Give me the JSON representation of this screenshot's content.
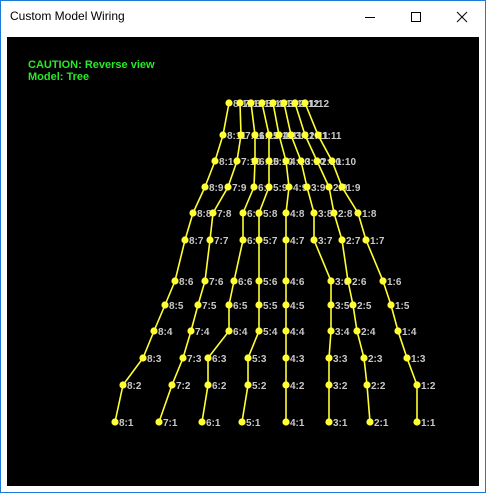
{
  "window": {
    "title": "Custom Model Wiring"
  },
  "overlay": {
    "caution": "CAUTION: Reverse view",
    "model": "Model: Tree"
  },
  "colors": {
    "background": "#000000",
    "wire": "#ffff33",
    "node": "#ffff33",
    "label": "#c8c8c8",
    "overlay_text": "#28e828"
  },
  "strings": [
    {
      "string": 8,
      "nodes": [
        "8:1",
        "8:2",
        "8:3",
        "8:4",
        "8:5",
        "8:6",
        "8:7",
        "8:8",
        "8:9",
        "8:10",
        "8:11",
        "8:12"
      ]
    },
    {
      "string": 7,
      "nodes": [
        "7:1",
        "7:2",
        "7:3",
        "7:4",
        "7:5",
        "7:6",
        "7:7",
        "7:8",
        "7:9",
        "7:10",
        "7:11",
        "7:12"
      ]
    },
    {
      "string": 6,
      "nodes": [
        "6:1",
        "6:2",
        "6:3",
        "6:4",
        "6:5",
        "6:6",
        "6:7",
        "6:8",
        "6:9",
        "6:10",
        "6:11",
        "6:12"
      ]
    },
    {
      "string": 5,
      "nodes": [
        "5:1",
        "5:2",
        "5:3",
        "5:4",
        "5:5",
        "5:6",
        "5:7",
        "5:8",
        "5:9",
        "5:10",
        "5:11",
        "5:12"
      ]
    },
    {
      "string": 4,
      "nodes": [
        "4:1",
        "4:2",
        "4:3",
        "4:4",
        "4:5",
        "4:6",
        "4:7",
        "4:8",
        "4:9",
        "4:10",
        "4:11",
        "4:12"
      ]
    },
    {
      "string": 3,
      "nodes": [
        "3:1",
        "3:2",
        "3:3",
        "3:4",
        "3:5",
        "3:6",
        "3:7",
        "3:8",
        "3:9",
        "3:10",
        "3:11",
        "3:12"
      ]
    },
    {
      "string": 2,
      "nodes": [
        "2:1",
        "2:2",
        "2:3",
        "2:4",
        "2:5",
        "2:6",
        "2:7",
        "2:8",
        "2:9",
        "2:10",
        "2:11",
        "2:12"
      ]
    },
    {
      "string": 1,
      "nodes": [
        "1:1",
        "1:2",
        "1:3",
        "1:4",
        "1:5",
        "1:6",
        "1:7",
        "1:8",
        "1:9",
        "1:10",
        "1:11",
        "1:12"
      ]
    }
  ]
}
